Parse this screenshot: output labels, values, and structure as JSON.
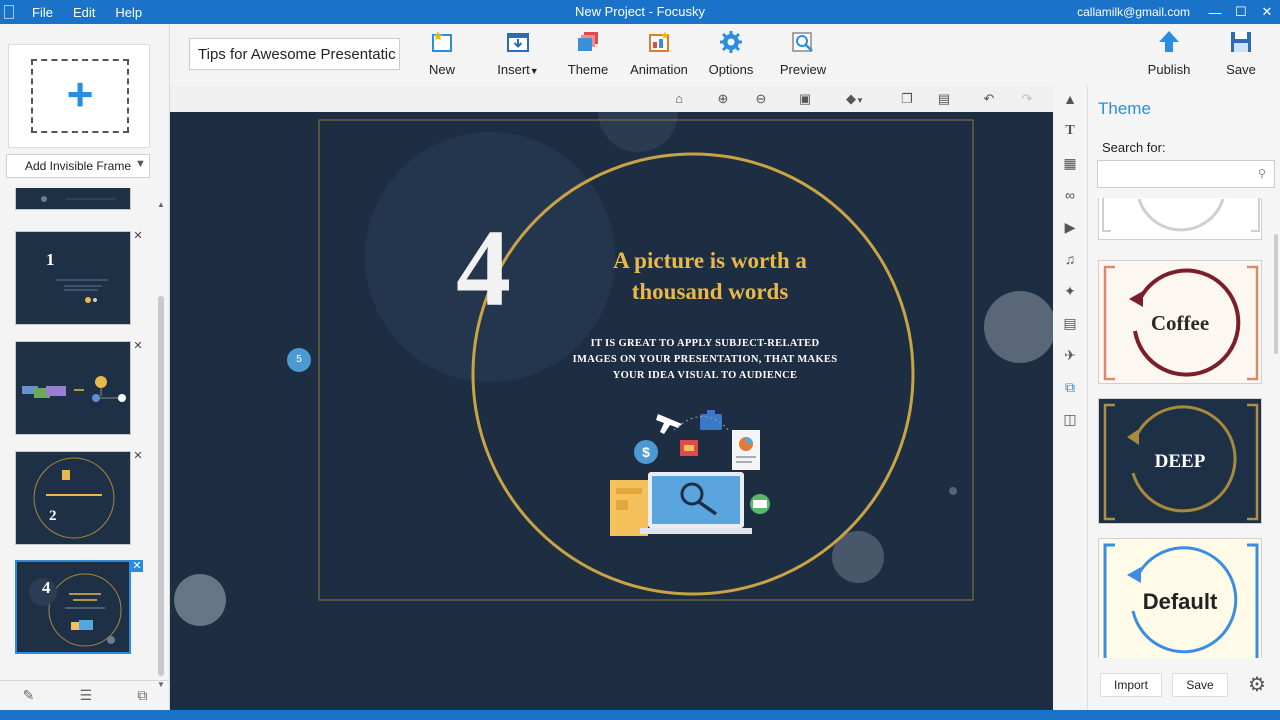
{
  "window": {
    "title": "New Project - Focusky",
    "account": "callamilk@gmail.com",
    "menu": [
      "File",
      "Edit",
      "Help"
    ]
  },
  "toolbar": {
    "project_title": "Tips for Awesome Presentatic",
    "new": "New",
    "insert": "Insert",
    "theme": "Theme",
    "animation": "Animation",
    "options": "Options",
    "preview": "Preview",
    "publish": "Publish",
    "save": "Save"
  },
  "left_panel": {
    "add_invisible_frame": "Add Invisible Frame",
    "thumbnails": [
      {
        "num": "1"
      },
      {
        "num": ""
      },
      {
        "num": "2"
      },
      {
        "num": "4"
      }
    ]
  },
  "canvas": {
    "slide_number": "4",
    "title_line1": "A picture is worth a",
    "title_line2": "thousand words",
    "body_line1": "IT IS GREAT TO APPLY SUBJECT-RELATED",
    "body_line2": "IMAGES ON YOUR PRESENTATION, THAT MAKES",
    "body_line3": "YOUR IDEA VISUAL TO AUDIENCE",
    "path_marker": "5"
  },
  "theme_panel": {
    "title": "Theme",
    "search_label": "Search for:",
    "search_value": "",
    "themes": [
      "Coffee",
      "DEEP",
      "Default"
    ],
    "import": "Import",
    "save": "Save"
  },
  "colors": {
    "accent": "#1a73c9",
    "canvas_bg": "#1d2d42",
    "gold": "#e7b84a"
  }
}
